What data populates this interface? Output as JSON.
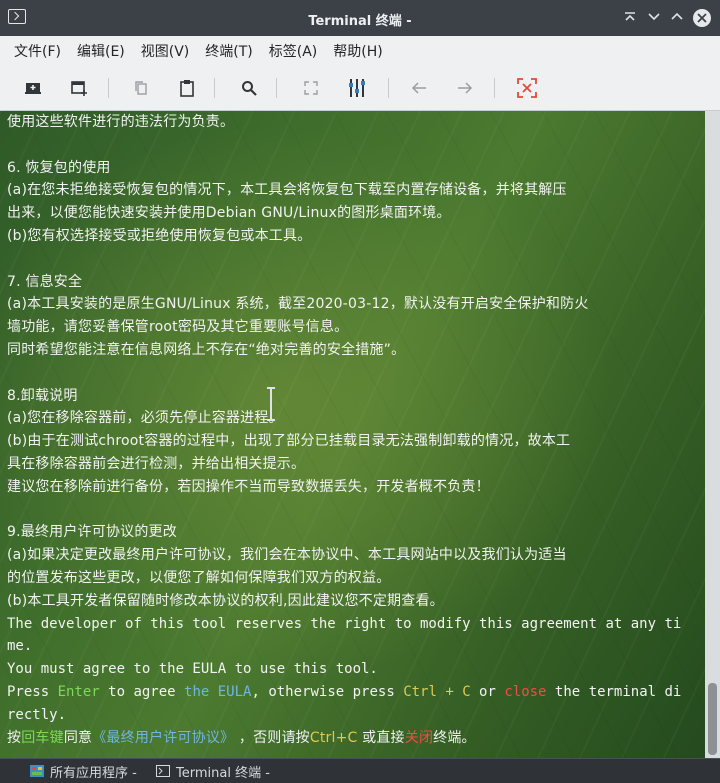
{
  "window": {
    "title": "Terminal 终端 -",
    "controls": [
      "minimize",
      "restore",
      "maximize",
      "close"
    ]
  },
  "menubar": {
    "items": [
      "文件(F)",
      "编辑(E)",
      "视图(V)",
      "终端(T)",
      "标签(A)",
      "帮助(H)"
    ]
  },
  "toolbar": {
    "icons": [
      "new-tab-icon",
      "new-window-icon",
      "copy-icon",
      "paste-icon",
      "search-icon",
      "fullscreen-icon",
      "preferences-icon",
      "back-arrow-icon",
      "forward-arrow-icon",
      "close-tab-icon"
    ],
    "accent_red": "#e04a3f"
  },
  "terminal": {
    "lines": [
      {
        "segments": [
          {
            "t": "使用这些软件进行的违法行为负责。",
            "c": ""
          }
        ]
      },
      {
        "segments": [
          {
            "t": "",
            "c": ""
          }
        ]
      },
      {
        "segments": [
          {
            "t": "6. 恢复包的使用",
            "c": ""
          }
        ]
      },
      {
        "segments": [
          {
            "t": "(a)在您未拒绝接受恢复包的情况下，本工具会将恢复包下载至内置存储设备，并将其解压",
            "c": ""
          }
        ]
      },
      {
        "segments": [
          {
            "t": "出来，以便您能快速安装并使用Debian GNU/Linux的图形桌面环境。",
            "c": ""
          }
        ]
      },
      {
        "segments": [
          {
            "t": "(b)您有权选择接受或拒绝使用恢复包或本工具。",
            "c": ""
          }
        ]
      },
      {
        "segments": [
          {
            "t": "",
            "c": ""
          }
        ]
      },
      {
        "segments": [
          {
            "t": "7. 信息安全",
            "c": ""
          }
        ]
      },
      {
        "segments": [
          {
            "t": "(a)本工具安装的是原生GNU/Linux 系统，截至2020-03-12，默认没有开启安全保护和防火",
            "c": ""
          }
        ]
      },
      {
        "segments": [
          {
            "t": "墙功能，请您妥善保管root密码及其它重要账号信息。",
            "c": ""
          }
        ]
      },
      {
        "segments": [
          {
            "t": "同时希望您能注意在信息网络上不存在“绝对完善的安全措施”。",
            "c": ""
          }
        ]
      },
      {
        "segments": [
          {
            "t": "",
            "c": ""
          }
        ]
      },
      {
        "segments": [
          {
            "t": "8.卸载说明",
            "c": ""
          }
        ]
      },
      {
        "segments": [
          {
            "t": "(a)您在移除容器前，必须先停止容器进程。",
            "c": ""
          }
        ]
      },
      {
        "segments": [
          {
            "t": "(b)由于在测试chroot容器的过程中，出现了部分已挂载目录无法强制卸载的情况，故本工",
            "c": ""
          }
        ]
      },
      {
        "segments": [
          {
            "t": "具在移除容器前会进行检测，并给出相关提示。",
            "c": ""
          }
        ]
      },
      {
        "segments": [
          {
            "t": "建议您在移除前进行备份，若因操作不当而导致数据丢失，开发者概不负责！",
            "c": ""
          }
        ]
      },
      {
        "segments": [
          {
            "t": "",
            "c": ""
          }
        ]
      },
      {
        "segments": [
          {
            "t": "9.最终用户许可协议的更改",
            "c": ""
          }
        ]
      },
      {
        "segments": [
          {
            "t": "(a)如果决定更改最终用户许可协议，我们会在本协议中、本工具网站中以及我们认为适当",
            "c": ""
          }
        ]
      },
      {
        "segments": [
          {
            "t": "的位置发布这些更改，以便您了解如何保障我们双方的权益。",
            "c": ""
          }
        ]
      },
      {
        "segments": [
          {
            "t": "(b)本工具开发者保留随时修改本协议的权利,因此建议您不定期查看。",
            "c": ""
          }
        ]
      },
      {
        "segments": [
          {
            "t": "The developer of this tool reserves the right to modify this agreement at any ti",
            "c": ""
          }
        ]
      },
      {
        "segments": [
          {
            "t": "me.",
            "c": ""
          }
        ]
      },
      {
        "segments": [
          {
            "t": "You must agree to the EULA to use this tool.",
            "c": ""
          }
        ]
      },
      {
        "segments": [
          {
            "t": "Press ",
            "c": ""
          },
          {
            "t": "Enter",
            "c": "green"
          },
          {
            "t": " to agree ",
            "c": ""
          },
          {
            "t": "the EULA",
            "c": "blue"
          },
          {
            "t": ", otherwise press ",
            "c": ""
          },
          {
            "t": "Ctrl + C",
            "c": "yellow"
          },
          {
            "t": " or ",
            "c": ""
          },
          {
            "t": "close",
            "c": "red"
          },
          {
            "t": " the terminal di",
            "c": ""
          }
        ]
      },
      {
        "segments": [
          {
            "t": "rectly.",
            "c": ""
          }
        ]
      },
      {
        "segments": [
          {
            "t": "按",
            "c": ""
          },
          {
            "t": "回车键",
            "c": "green"
          },
          {
            "t": "同意",
            "c": ""
          },
          {
            "t": "《最终用户许可协议》",
            "c": "blue"
          },
          {
            "t": " ，否则请按",
            "c": ""
          },
          {
            "t": "Ctrl+C",
            "c": "yellow"
          },
          {
            "t": " 或直接",
            "c": ""
          },
          {
            "t": "关闭",
            "c": "red"
          },
          {
            "t": "终端。",
            "c": ""
          }
        ]
      }
    ],
    "colors": {
      "green": "#7ed957",
      "yellow": "#e2c94f",
      "blue": "#6fb6e0",
      "red": "#ef4d45"
    }
  },
  "taskbar": {
    "items": [
      {
        "label": "所有应用程序 -"
      },
      {
        "label": "Terminal 终端 -"
      }
    ]
  }
}
